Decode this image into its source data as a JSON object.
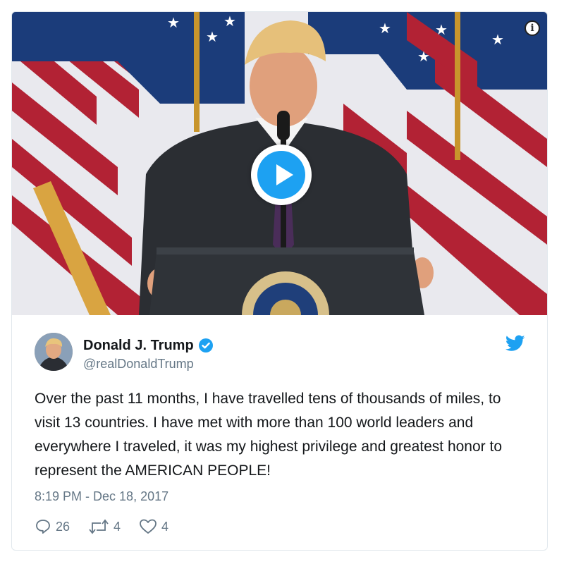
{
  "tweet": {
    "name": "Donald J. Trump",
    "handle": "@realDonaldTrump",
    "text": "Over the past 11 months, I have travelled tens of thousands of miles, to visit 13 countries. I have met with more than 100 world leaders and everywhere I traveled, it was my highest privilege and greatest honor to represent the AMERICAN PEOPLE!",
    "timestamp": "8:19 PM - Dec 18, 2017",
    "replies": "26",
    "retweets": "4",
    "likes": "4"
  },
  "media": {
    "info_label": "i"
  },
  "icons": {
    "info": "info-icon",
    "play": "play-icon",
    "verified": "verified-badge-icon",
    "bird": "twitter-bird-icon",
    "reply": "reply-icon",
    "retweet": "retweet-icon",
    "like": "heart-icon"
  },
  "colors": {
    "accent": "#1da1f2",
    "text": "#14171a",
    "muted": "#657786"
  }
}
